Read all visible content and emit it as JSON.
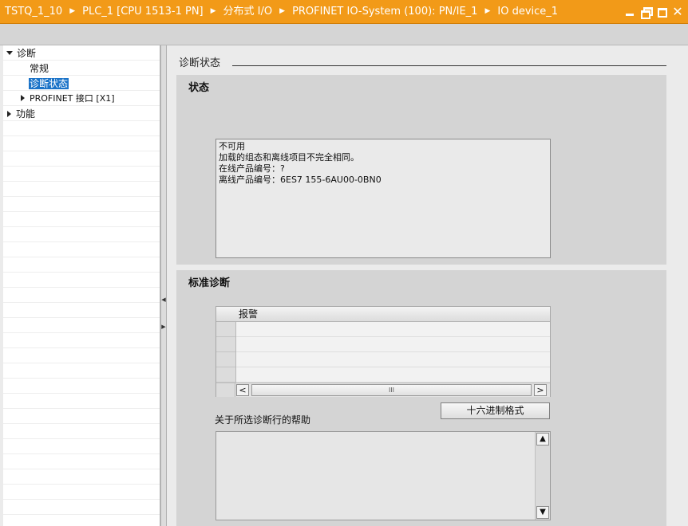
{
  "breadcrumb": {
    "items": [
      "TSTQ_1_10",
      "PLC_1 [CPU 1513-1 PN]",
      "分布式 I/O",
      "PROFINET IO-System (100): PN/IE_1",
      "IO device_1"
    ],
    "separator": "▶"
  },
  "window_controls": {
    "close": "✕"
  },
  "nav": {
    "items": [
      {
        "label": "诊断"
      },
      {
        "label": "常规"
      },
      {
        "label": "诊断状态"
      },
      {
        "label": "PROFINET 接口 [X1]"
      },
      {
        "label": "功能"
      }
    ]
  },
  "splitter": {
    "left_arrow": "◀",
    "right_arrow": "▶"
  },
  "content": {
    "title": "诊断状态",
    "status_panel": {
      "title": "状态",
      "lines": [
        "不可用",
        "加载的组态和离线项目不完全相同。",
        "在线产品编号：?",
        "离线产品编号：6ES7 155-6AU00-0BN0"
      ]
    },
    "std_panel": {
      "title": "标准诊断",
      "column_header": "报警",
      "scroll_left": "<",
      "scroll_thumb": "III",
      "scroll_right": ">",
      "hex_button": "十六进制格式",
      "help_label": "关于所选诊断行的帮助",
      "scroll_up": "▲",
      "scroll_down": "▼"
    }
  },
  "colors": {
    "title_bar": "#f29a18",
    "selection": "#1b73c8"
  }
}
